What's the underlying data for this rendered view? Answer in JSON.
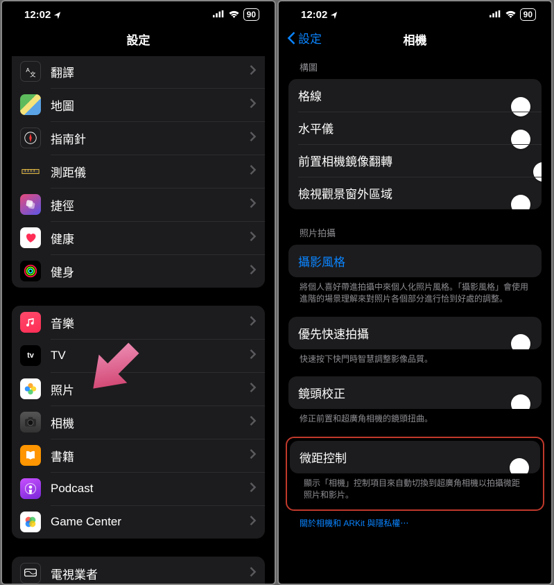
{
  "status": {
    "time": "12:02",
    "battery": "90"
  },
  "left": {
    "title": "設定",
    "g1": [
      {
        "label": "翻譯",
        "iconName": "translate-icon"
      },
      {
        "label": "地圖",
        "iconName": "maps-icon"
      },
      {
        "label": "指南針",
        "iconName": "compass-icon"
      },
      {
        "label": "測距儀",
        "iconName": "measure-icon"
      },
      {
        "label": "捷徑",
        "iconName": "shortcuts-icon"
      },
      {
        "label": "健康",
        "iconName": "health-icon"
      },
      {
        "label": "健身",
        "iconName": "fitness-icon"
      }
    ],
    "g2": [
      {
        "label": "音樂",
        "iconName": "music-icon"
      },
      {
        "label": "TV",
        "iconName": "tv-icon"
      },
      {
        "label": "照片",
        "iconName": "photos-icon"
      },
      {
        "label": "相機",
        "iconName": "camera-icon"
      },
      {
        "label": "書籍",
        "iconName": "books-icon"
      },
      {
        "label": "Podcast",
        "iconName": "podcasts-icon"
      },
      {
        "label": "Game Center",
        "iconName": "gamecenter-icon"
      }
    ],
    "g3": [
      {
        "label": "電視業者",
        "iconName": "tvprovider-icon"
      }
    ]
  },
  "right": {
    "back": "設定",
    "title": "相機",
    "compositionHeader": "構圖",
    "composition": [
      {
        "label": "格線",
        "on": true
      },
      {
        "label": "水平儀",
        "on": true
      },
      {
        "label": "前置相機鏡像翻轉",
        "on": false
      },
      {
        "label": "檢視觀景窗外區域",
        "on": true
      }
    ],
    "photoHeader": "照片拍攝",
    "stylesLink": "攝影風格",
    "stylesFooter": "將個人喜好帶進拍攝中來個人化照片風格。「攝影風格」會使用進階的場景理解來對照片各個部分進行恰到好處的調整。",
    "fast": {
      "label": "優先快速拍攝",
      "on": true
    },
    "fastFooter": "快速按下快門時智慧調整影像品質。",
    "lens": {
      "label": "鏡頭校正",
      "on": true
    },
    "lensFooter": "修正前置和超廣角相機的鏡頭扭曲。",
    "macro": {
      "label": "微距控制",
      "on": true
    },
    "macroFooter": "顯示「相機」控制項目來自動切換到超廣角相機以拍攝微距照片和影片。",
    "privacyLink": "關於相機和 ARKit 與隱私權⋯"
  }
}
